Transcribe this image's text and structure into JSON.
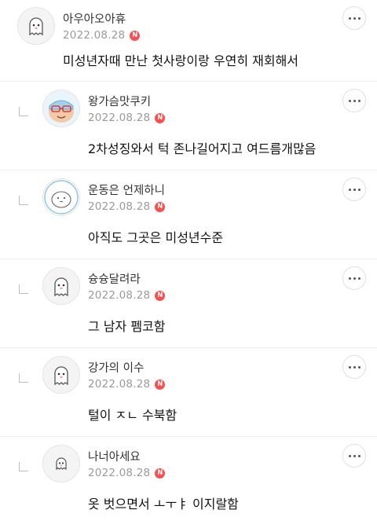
{
  "comments": [
    {
      "nickname": "아우아오아휴",
      "date": "2022.08.28",
      "badge": "N",
      "text": "미성년자때 만난 첫사랑이랑 우연히 재회해서"
    },
    {
      "nickname": "왕가슴맛쿠키",
      "date": "2022.08.28",
      "badge": "N",
      "text": "2차성징와서 턱 존나길어지고 여드름개많음"
    },
    {
      "nickname": "운동은 언제하니",
      "date": "2022.08.28",
      "badge": "N",
      "text": "아직도 그곳은 미성년수준"
    },
    {
      "nickname": "슝슝달려라",
      "date": "2022.08.28",
      "badge": "N",
      "text": "그 남자 펨코함"
    },
    {
      "nickname": "강가의 이수",
      "date": "2022.08.28",
      "badge": "N",
      "text": "털이 ㅈㄴ 수북함"
    },
    {
      "nickname": "나너아세요",
      "date": "2022.08.28",
      "badge": "N",
      "text": "옷 벗으면서 ㅗㅜㅑ 이지랄함"
    }
  ],
  "colors": {
    "badge": "#ff4d4d",
    "date": "#9a9a9a",
    "divider": "#ececec"
  },
  "icons": {
    "more": "more-options-icon",
    "reply": "reply-arrow-icon",
    "badge": "new-badge-icon"
  }
}
